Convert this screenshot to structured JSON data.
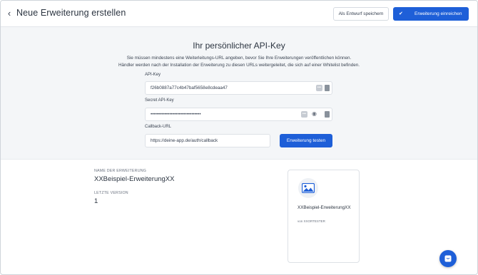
{
  "header": {
    "back_icon": "chevron-left-icon",
    "title": "Neue Erweiterung erstellen",
    "draft_label": "Als Entwurf speichern",
    "submit_label": "Erweiterung einreichen",
    "submit_icon": "checkmark-icon"
  },
  "api": {
    "title": "Ihr persönlicher API-Key",
    "description_line1": "Sie müssen mindestens eine Weiterleitungs-URL angeben, bevor Sie Ihre Erweiterungen veröffentlichen können.",
    "description_line2": "Händler werden nach der Installation der Erweiterung zu diesen URLs weitergeleitet, die sich auf einer Whitelist befinden.",
    "api_key_label": "API-Key",
    "api_key_value": "f26b0887a77c4b47baf5658e8cdeaa47",
    "secret_label": "Secret API-Key",
    "secret_value": "••••••••••••••••••••••••••••••••",
    "callback_label": "Callback-URL",
    "callback_value": "https://deine-app.de/auth/callback",
    "test_button": "Erweiterung testen"
  },
  "info": {
    "name_label": "NAME DER ERWEITERUNG",
    "name_value": "XXBeispiel-ErweiterungXX",
    "version_label": "LETZTE VERSION",
    "version_value": "1"
  },
  "preview": {
    "icon": "image-icon",
    "name": "XXBeispiel-ErweiterungXX",
    "by": "von XXORTESTER"
  },
  "fab": {
    "icon": "support-icon"
  },
  "colors": {
    "primary": "#1e5fd8",
    "section_bg": "#f4f6f8"
  }
}
